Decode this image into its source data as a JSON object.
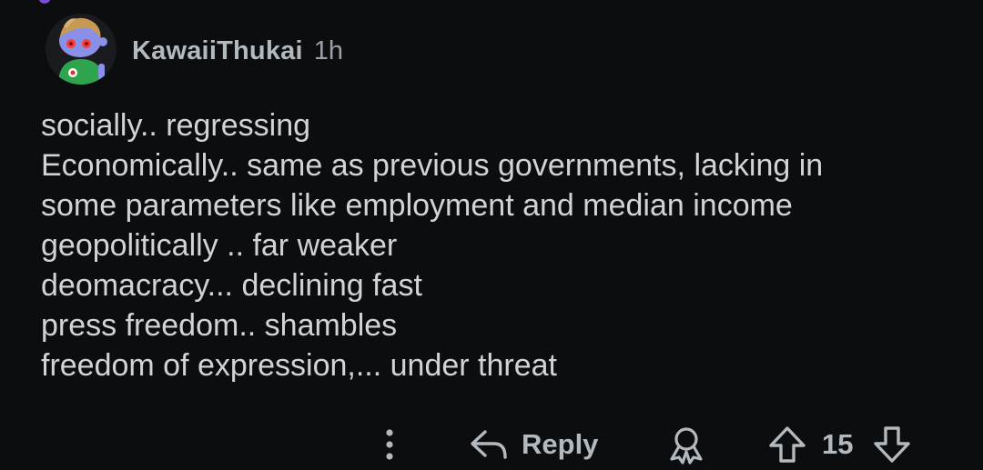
{
  "comment": {
    "author": "KawaiiThukai",
    "timestamp": "1h",
    "body_lines": [
      "socially.. regressing",
      "Economically.. same as previous governments, lacking in",
      "some parameters like employment and median income",
      "geopolitically .. far weaker",
      "deomacracy... declining fast",
      "press freedom.. shambles",
      "freedom of expression,... under threat"
    ]
  },
  "actions": {
    "more_icon": "vertical-dots-icon",
    "reply_icon": "reply-arrow-icon",
    "reply_label": "Reply",
    "award_icon": "award-ribbon-icon",
    "upvote_icon": "up-arrow-icon",
    "score": "15",
    "downvote_icon": "down-arrow-icon"
  },
  "colors": {
    "background": "#0b0d0f",
    "text": "#d0d4d7",
    "muted": "#b3babf"
  }
}
